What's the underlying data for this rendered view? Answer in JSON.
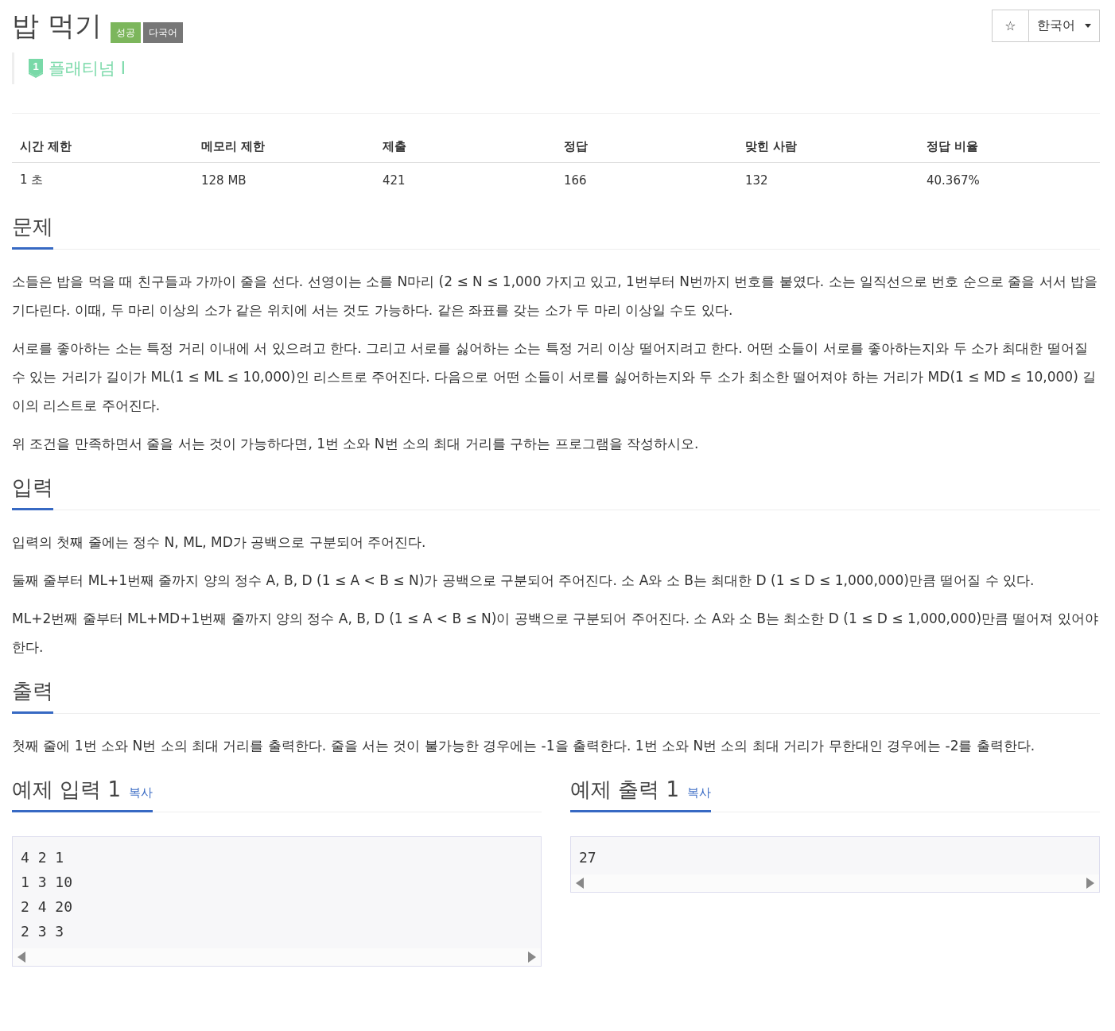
{
  "title": "밥 먹기",
  "badges": [
    {
      "label": "성공",
      "color": "#7cb65c"
    },
    {
      "label": "다국어",
      "color": "#777777"
    }
  ],
  "tier": {
    "number": "1",
    "label": "플래티넘 I"
  },
  "star_button": {
    "label": "☆"
  },
  "language_select": {
    "value": "한국어"
  },
  "stats": {
    "columns": [
      "시간 제한",
      "메모리 제한",
      "제출",
      "정답",
      "맞힌 사람",
      "정답 비율"
    ],
    "rows": [
      [
        "1 초",
        "128 MB",
        "421",
        "166",
        "132",
        "40.367%"
      ]
    ]
  },
  "sections": [
    {
      "heading": "문제",
      "paragraphs": [
        "소들은 밥을 먹을 때 친구들과 가까이 줄을 선다. 선영이는 소를 N마리 (2 ≤ N ≤ 1,000 가지고 있고, 1번부터 N번까지 번호를 붙였다. 소는 일직선으로 번호 순으로 줄을 서서 밥을 기다린다. 이때, 두 마리 이상의 소가 같은 위치에 서는 것도 가능하다. 같은 좌표를 갖는 소가 두 마리 이상일 수도 있다.",
        "서로를 좋아하는 소는 특정 거리 이내에 서 있으려고 한다. 그리고 서로를 싫어하는 소는 특정 거리 이상 떨어지려고 한다. 어떤 소들이 서로를 좋아하는지와 두 소가 최대한 떨어질 수 있는 거리가 길이가 ML(1 ≤ ML ≤ 10,000)인 리스트로 주어진다. 다음으로 어떤 소들이 서로를 싫어하는지와 두 소가 최소한 떨어져야 하는 거리가 MD(1 ≤ MD ≤ 10,000) 길이의 리스트로 주어진다.",
        "위 조건을 만족하면서 줄을 서는 것이 가능하다면, 1번 소와 N번 소의 최대 거리를 구하는 프로그램을 작성하시오."
      ]
    },
    {
      "heading": "입력",
      "paragraphs": [
        "입력의 첫째 줄에는 정수 N, ML, MD가 공백으로 구분되어 주어진다.",
        "둘째 줄부터 ML+1번째 줄까지 양의 정수 A, B, D (1 ≤ A < B ≤ N)가 공백으로 구분되어 주어진다. 소 A와 소 B는 최대한 D (1 ≤ D ≤ 1,000,000)만큼 떨어질 수 있다.",
        "ML+2번째 줄부터 ML+MD+1번째 줄까지 양의 정수 A, B, D (1  ≤ A < B ≤ N)이 공백으로 구분되어 주어진다. 소 A와 소 B는 최소한 D (1 ≤ D ≤ 1,000,000)만큼 떨어져 있어야 한다."
      ]
    },
    {
      "heading": "출력",
      "paragraphs": [
        "첫째 줄에 1번 소와 N번 소의 최대 거리를 출력한다. 줄을 서는 것이 불가능한 경우에는 -1을 출력한다. 1번 소와 N번 소의 최대 거리가 무한대인 경우에는 -2를 출력한다."
      ]
    }
  ],
  "samples": [
    {
      "heading": "예제 입력 1",
      "copy_link": "복사",
      "lines": [
        "4 2 1",
        "1 3 10",
        "2 4 20",
        "2 3 3"
      ]
    },
    {
      "heading": "예제 출력 1",
      "copy_link": "복사",
      "lines": [
        "27"
      ]
    }
  ]
}
